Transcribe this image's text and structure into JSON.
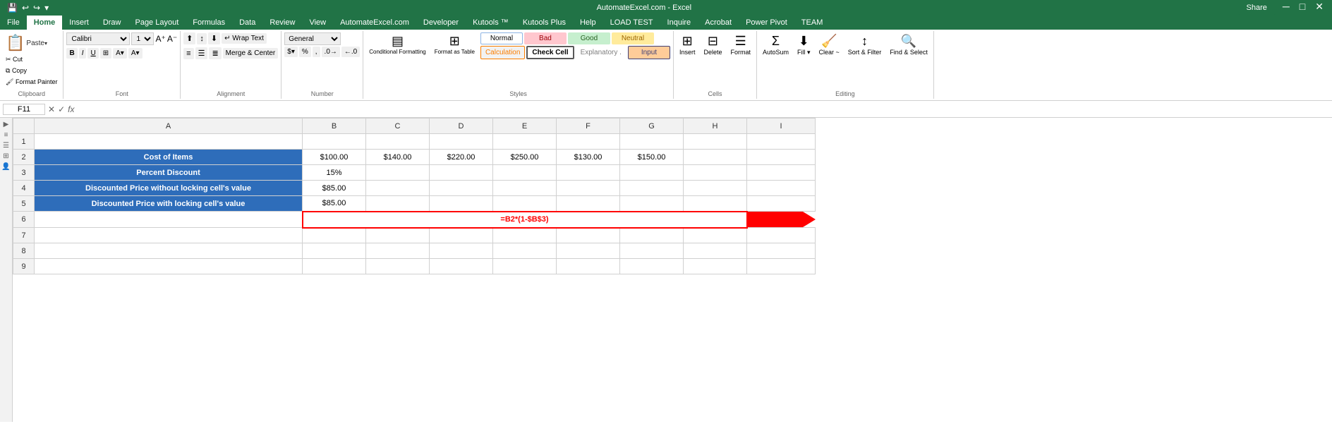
{
  "titlebar": {
    "title": "AutomateExcel.com - Excel",
    "share_label": "Share"
  },
  "ribbon": {
    "tabs": [
      "File",
      "Home",
      "Insert",
      "Draw",
      "Page Layout",
      "Formulas",
      "Data",
      "Review",
      "View",
      "AutomateExcel.com",
      "Developer",
      "Kutools ™",
      "Kutools Plus",
      "Help",
      "LOAD TEST",
      "Inquire",
      "Acrobat",
      "Power Pivot",
      "TEAM"
    ],
    "active_tab": "Home",
    "groups": {
      "clipboard": {
        "label": "Clipboard",
        "paste": "Paste",
        "cut": "Cut",
        "copy": "Copy",
        "format_painter": "Format Painter"
      },
      "font": {
        "label": "Font",
        "font_name": "Calibri",
        "font_size": "11"
      },
      "alignment": {
        "label": "Alignment",
        "wrap_text": "Wrap Text",
        "merge_center": "Merge & Center"
      },
      "number": {
        "label": "Number",
        "format": "General"
      },
      "styles": {
        "label": "Styles",
        "conditional_formatting": "Conditional Formatting",
        "format_as_table": "Format as Table",
        "normal": "Normal",
        "bad": "Bad",
        "good": "Good",
        "neutral": "Neutral",
        "calculation": "Calculation",
        "check_cell": "Check Cell",
        "explanatory": "Explanatory .",
        "input": "Input"
      },
      "cells": {
        "label": "Cells",
        "insert": "Insert",
        "delete": "Delete",
        "format": "Format"
      },
      "editing": {
        "label": "Editing",
        "autosum": "AutoSum",
        "fill": "Fill ▾",
        "clear": "Clear ~",
        "sort_filter": "Sort & Filter",
        "find_select": "Find & Select"
      }
    }
  },
  "formula_bar": {
    "name_box": "F11",
    "formula": ""
  },
  "sheet": {
    "col_headers": [
      "",
      "A",
      "B",
      "C",
      "D",
      "E",
      "F",
      "G",
      "H",
      "I"
    ],
    "rows": [
      {
        "num": 1,
        "cells": [
          "",
          "",
          "",
          "",
          "",
          "",
          "",
          "",
          ""
        ]
      },
      {
        "num": 2,
        "cells": [
          "Cost of Items",
          "$100.00",
          "$140.00",
          "$220.00",
          "$250.00",
          "$130.00",
          "$150.00",
          "",
          ""
        ]
      },
      {
        "num": 3,
        "cells": [
          "Percent Discount",
          "15%",
          "",
          "",
          "",
          "",
          "",
          "",
          ""
        ]
      },
      {
        "num": 4,
        "cells": [
          "Discounted Price without locking cell's value",
          "$85.00",
          "",
          "",
          "",
          "",
          "",
          "",
          ""
        ]
      },
      {
        "num": 5,
        "cells": [
          "Discounted Price with locking cell's value",
          "$85.00",
          "",
          "",
          "",
          "",
          "",
          "",
          ""
        ]
      },
      {
        "num": 6,
        "cells": [
          "",
          "=B2*(1-$B$3)",
          "",
          "",
          "",
          "",
          "",
          "",
          ""
        ]
      },
      {
        "num": 7,
        "cells": [
          "",
          "",
          "",
          "",
          "",
          "",
          "",
          "",
          ""
        ]
      },
      {
        "num": 8,
        "cells": [
          "",
          "",
          "",
          "",
          "",
          "",
          "",
          "",
          ""
        ]
      },
      {
        "num": 9,
        "cells": [
          "",
          "",
          "",
          "",
          "",
          "",
          "",
          "",
          ""
        ]
      }
    ],
    "formula_cell": "=B2*(1-$B$3)"
  }
}
